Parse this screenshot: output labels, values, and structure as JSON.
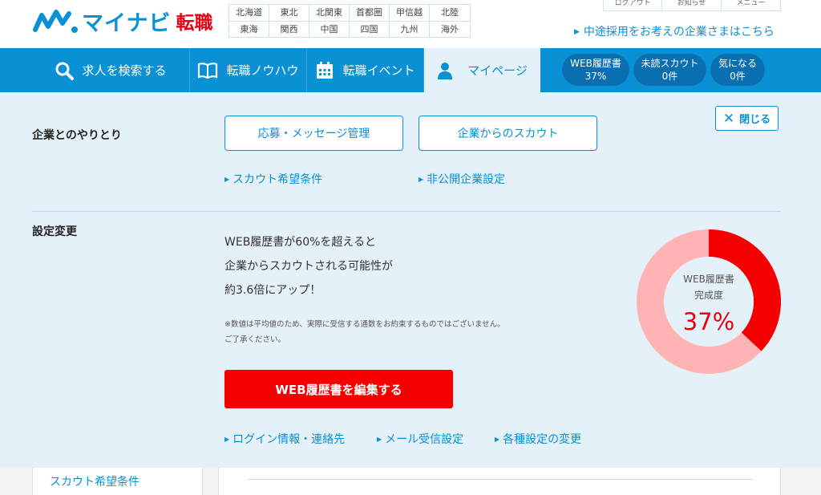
{
  "brand": {
    "name": "マイナビ",
    "sub": "転職",
    "primary_color": "#0a90d4",
    "accent_color": "#e60012"
  },
  "regions": [
    "北海道",
    "東北",
    "北関東",
    "首都圏",
    "甲信越",
    "北陸",
    "東海",
    "関西",
    "中国",
    "四国",
    "九州",
    "海外"
  ],
  "util_links": [
    "ログアウト",
    "お知らせ",
    "メニュー"
  ],
  "corp_link": "中途採用をお考えの企業さまはこちら",
  "nav": {
    "search": "求人を検索する",
    "knowhow": "転職ノウハウ",
    "event": "転職イベント",
    "mypage": "マイページ"
  },
  "pills": [
    {
      "label": "WEB履歴書",
      "value": "37%"
    },
    {
      "label": "未読スカウト",
      "value": "0件"
    },
    {
      "label": "気になる",
      "value": "0件"
    }
  ],
  "panel": {
    "close_label": "閉じる",
    "contact": {
      "title": "企業とのやりとり",
      "btn_application": "応募・メッセージ管理",
      "btn_scout": "企業からのスカウト",
      "link_scout_pref": "スカウト希望条件",
      "link_private": "非公開企業設定"
    },
    "settings": {
      "title": "設定変更",
      "promo_lines": [
        "WEB履歴書が60%を超えると",
        "企業からスカウトされる可能性が",
        "約3.6倍にアップ！"
      ],
      "note_lines": [
        "※数値は平均値のため、実際に受信する通数をお約束するものではございません。",
        "ご了承ください。"
      ],
      "edit_button": "WEB履歴書を編集する",
      "links": [
        "ログイン情報・連絡先",
        "メール受信設定",
        "各種設定の変更"
      ]
    },
    "resume_progress": {
      "label_line1": "WEB履歴書",
      "label_line2": "完成度",
      "percent_text": "37%",
      "fraction": 0.37,
      "fill_color": "#f40000",
      "track_color": "#ffb3b3"
    }
  },
  "bottom": {
    "side_item": "スカウト希望条件"
  }
}
